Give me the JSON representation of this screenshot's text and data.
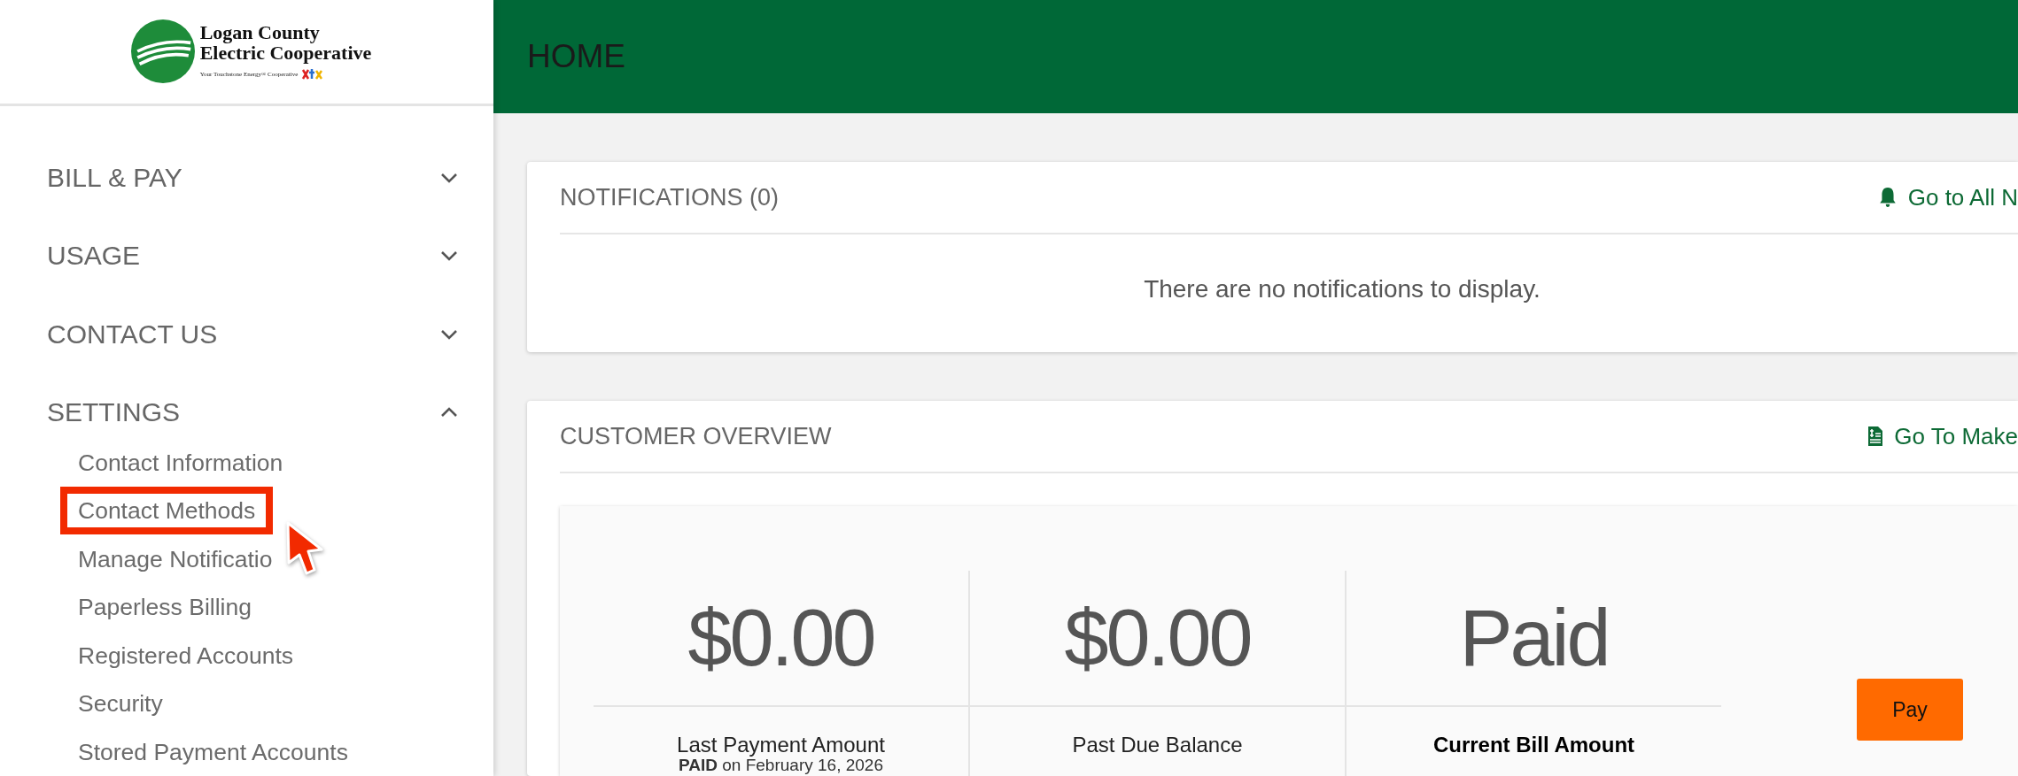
{
  "logo": {
    "name_line_1": "Logan County",
    "name_line_2": "Electric Cooperative",
    "tagline": "Your Touchstone Energy® Cooperative"
  },
  "header": {
    "title": "HOME"
  },
  "sidebar": {
    "sections": [
      {
        "label": "BILL & PAY",
        "expanded": false
      },
      {
        "label": "USAGE",
        "expanded": false
      },
      {
        "label": "CONTACT US",
        "expanded": false
      },
      {
        "label": "SETTINGS",
        "expanded": true,
        "items": [
          {
            "label": "Contact Information",
            "highlighted": false
          },
          {
            "label": "Contact Methods",
            "highlighted": true
          },
          {
            "label": "Manage Notificatio",
            "highlighted": false
          },
          {
            "label": "Paperless Billing",
            "highlighted": false
          },
          {
            "label": "Registered Accounts",
            "highlighted": false
          },
          {
            "label": "Security",
            "highlighted": false
          },
          {
            "label": "Stored Payment Accounts",
            "highlighted": false
          }
        ]
      }
    ]
  },
  "notifications": {
    "title": "NOTIFICATIONS (0)",
    "link": "Go to All N",
    "message": "There are no notifications to display."
  },
  "customer_overview": {
    "title": "CUSTOMER OVERVIEW",
    "link": "Go To Make",
    "stats": [
      {
        "value": "$0.00",
        "label": "Last Payment Amount",
        "note": "**PAID** on February 16, 2026",
        "emphasis": false
      },
      {
        "value": "$0.00",
        "label": "Past Due Balance",
        "emphasis": false
      },
      {
        "value": "Paid",
        "label": "Current Bill Amount",
        "emphasis": true
      }
    ],
    "pay_button": "Pay"
  }
}
